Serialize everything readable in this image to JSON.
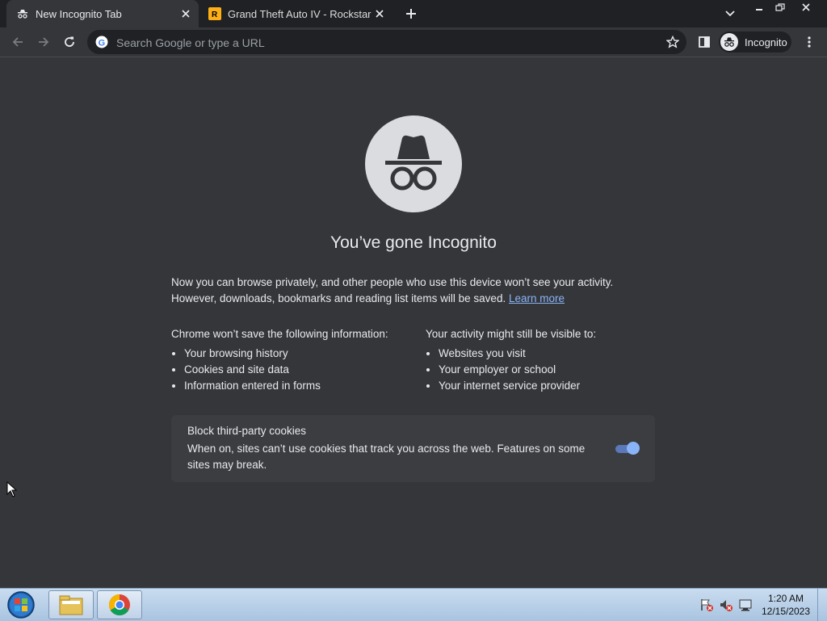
{
  "tabs": [
    {
      "title": "New Incognito Tab",
      "active": true
    },
    {
      "title": "Grand Theft Auto IV - Rockstar Games",
      "active": false
    }
  ],
  "omnibox": {
    "placeholder": "Search Google or type a URL"
  },
  "profile": {
    "label": "Incognito"
  },
  "page": {
    "heading": "You’ve gone Incognito",
    "intro_line1": "Now you can browse privately, and other people who use this device won’t see your activity.",
    "intro_line2": "However, downloads, bookmarks and reading list items will be saved.",
    "learn_more": "Learn more",
    "left_column": {
      "heading": "Chrome won’t save the following information:",
      "items": [
        "Your browsing history",
        "Cookies and site data",
        "Information entered in forms"
      ]
    },
    "right_column": {
      "heading": "Your activity might still be visible to:",
      "items": [
        "Websites you visit",
        "Your employer or school",
        "Your internet service provider"
      ]
    },
    "cookie_card": {
      "title": "Block third-party cookies",
      "description": "When on, sites can’t use cookies that track you across the web. Features on some sites may break.",
      "toggle_on": true
    }
  },
  "taskbar": {
    "time": "1:20 AM",
    "date": "12/15/2023"
  },
  "colors": {
    "background": "#35363a",
    "tabstrip": "#202124",
    "link": "#8ab4f8",
    "toggle_accent": "#8ab4f8"
  }
}
